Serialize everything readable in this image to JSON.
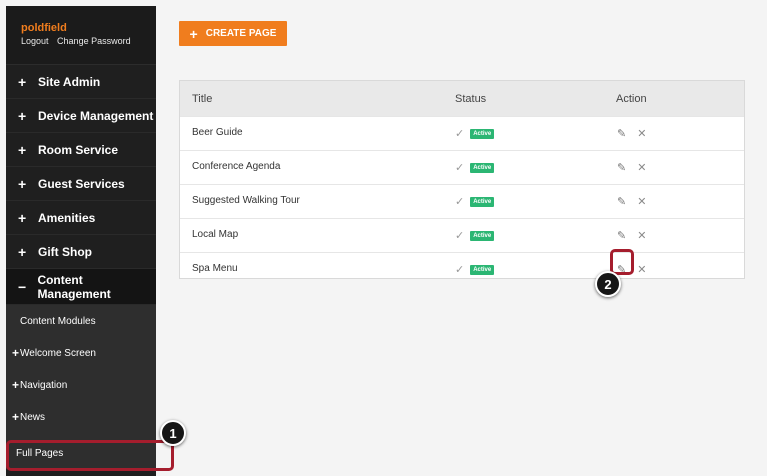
{
  "user": {
    "name": "poldfield",
    "logout": "Logout",
    "change_password": "Change Password"
  },
  "nav": [
    {
      "symbol": "+",
      "label": "Site Admin"
    },
    {
      "symbol": "+",
      "label": "Device Management"
    },
    {
      "symbol": "+",
      "label": "Room Service"
    },
    {
      "symbol": "+",
      "label": "Guest Services"
    },
    {
      "symbol": "+",
      "label": "Amenities"
    },
    {
      "symbol": "+",
      "label": "Gift Shop"
    },
    {
      "symbol": "−",
      "label": "Content Management"
    }
  ],
  "subnav": [
    {
      "symbol": "",
      "label": "Content Modules"
    },
    {
      "symbol": "+",
      "label": "Welcome Screen"
    },
    {
      "symbol": "+",
      "label": "Navigation"
    },
    {
      "symbol": "+",
      "label": "News"
    },
    {
      "symbol": "",
      "label": "Full Pages"
    }
  ],
  "create_button": {
    "icon": "+",
    "label": "CREATE PAGE"
  },
  "table": {
    "headers": {
      "title": "Title",
      "status": "Status",
      "action": "Action"
    },
    "rows": [
      {
        "title": "Beer Guide",
        "status": "Active"
      },
      {
        "title": "Conference Agenda",
        "status": "Active"
      },
      {
        "title": "Suggested Walking Tour",
        "status": "Active"
      },
      {
        "title": "Local Map",
        "status": "Active"
      },
      {
        "title": "Spa Menu",
        "status": "Active"
      }
    ]
  },
  "markers": {
    "one": "1",
    "two": "2"
  },
  "colors": {
    "accent": "#f07d1e",
    "active_badge": "#2bb673",
    "highlight": "#a51d2d",
    "sidebar": "#1f1f1f"
  }
}
